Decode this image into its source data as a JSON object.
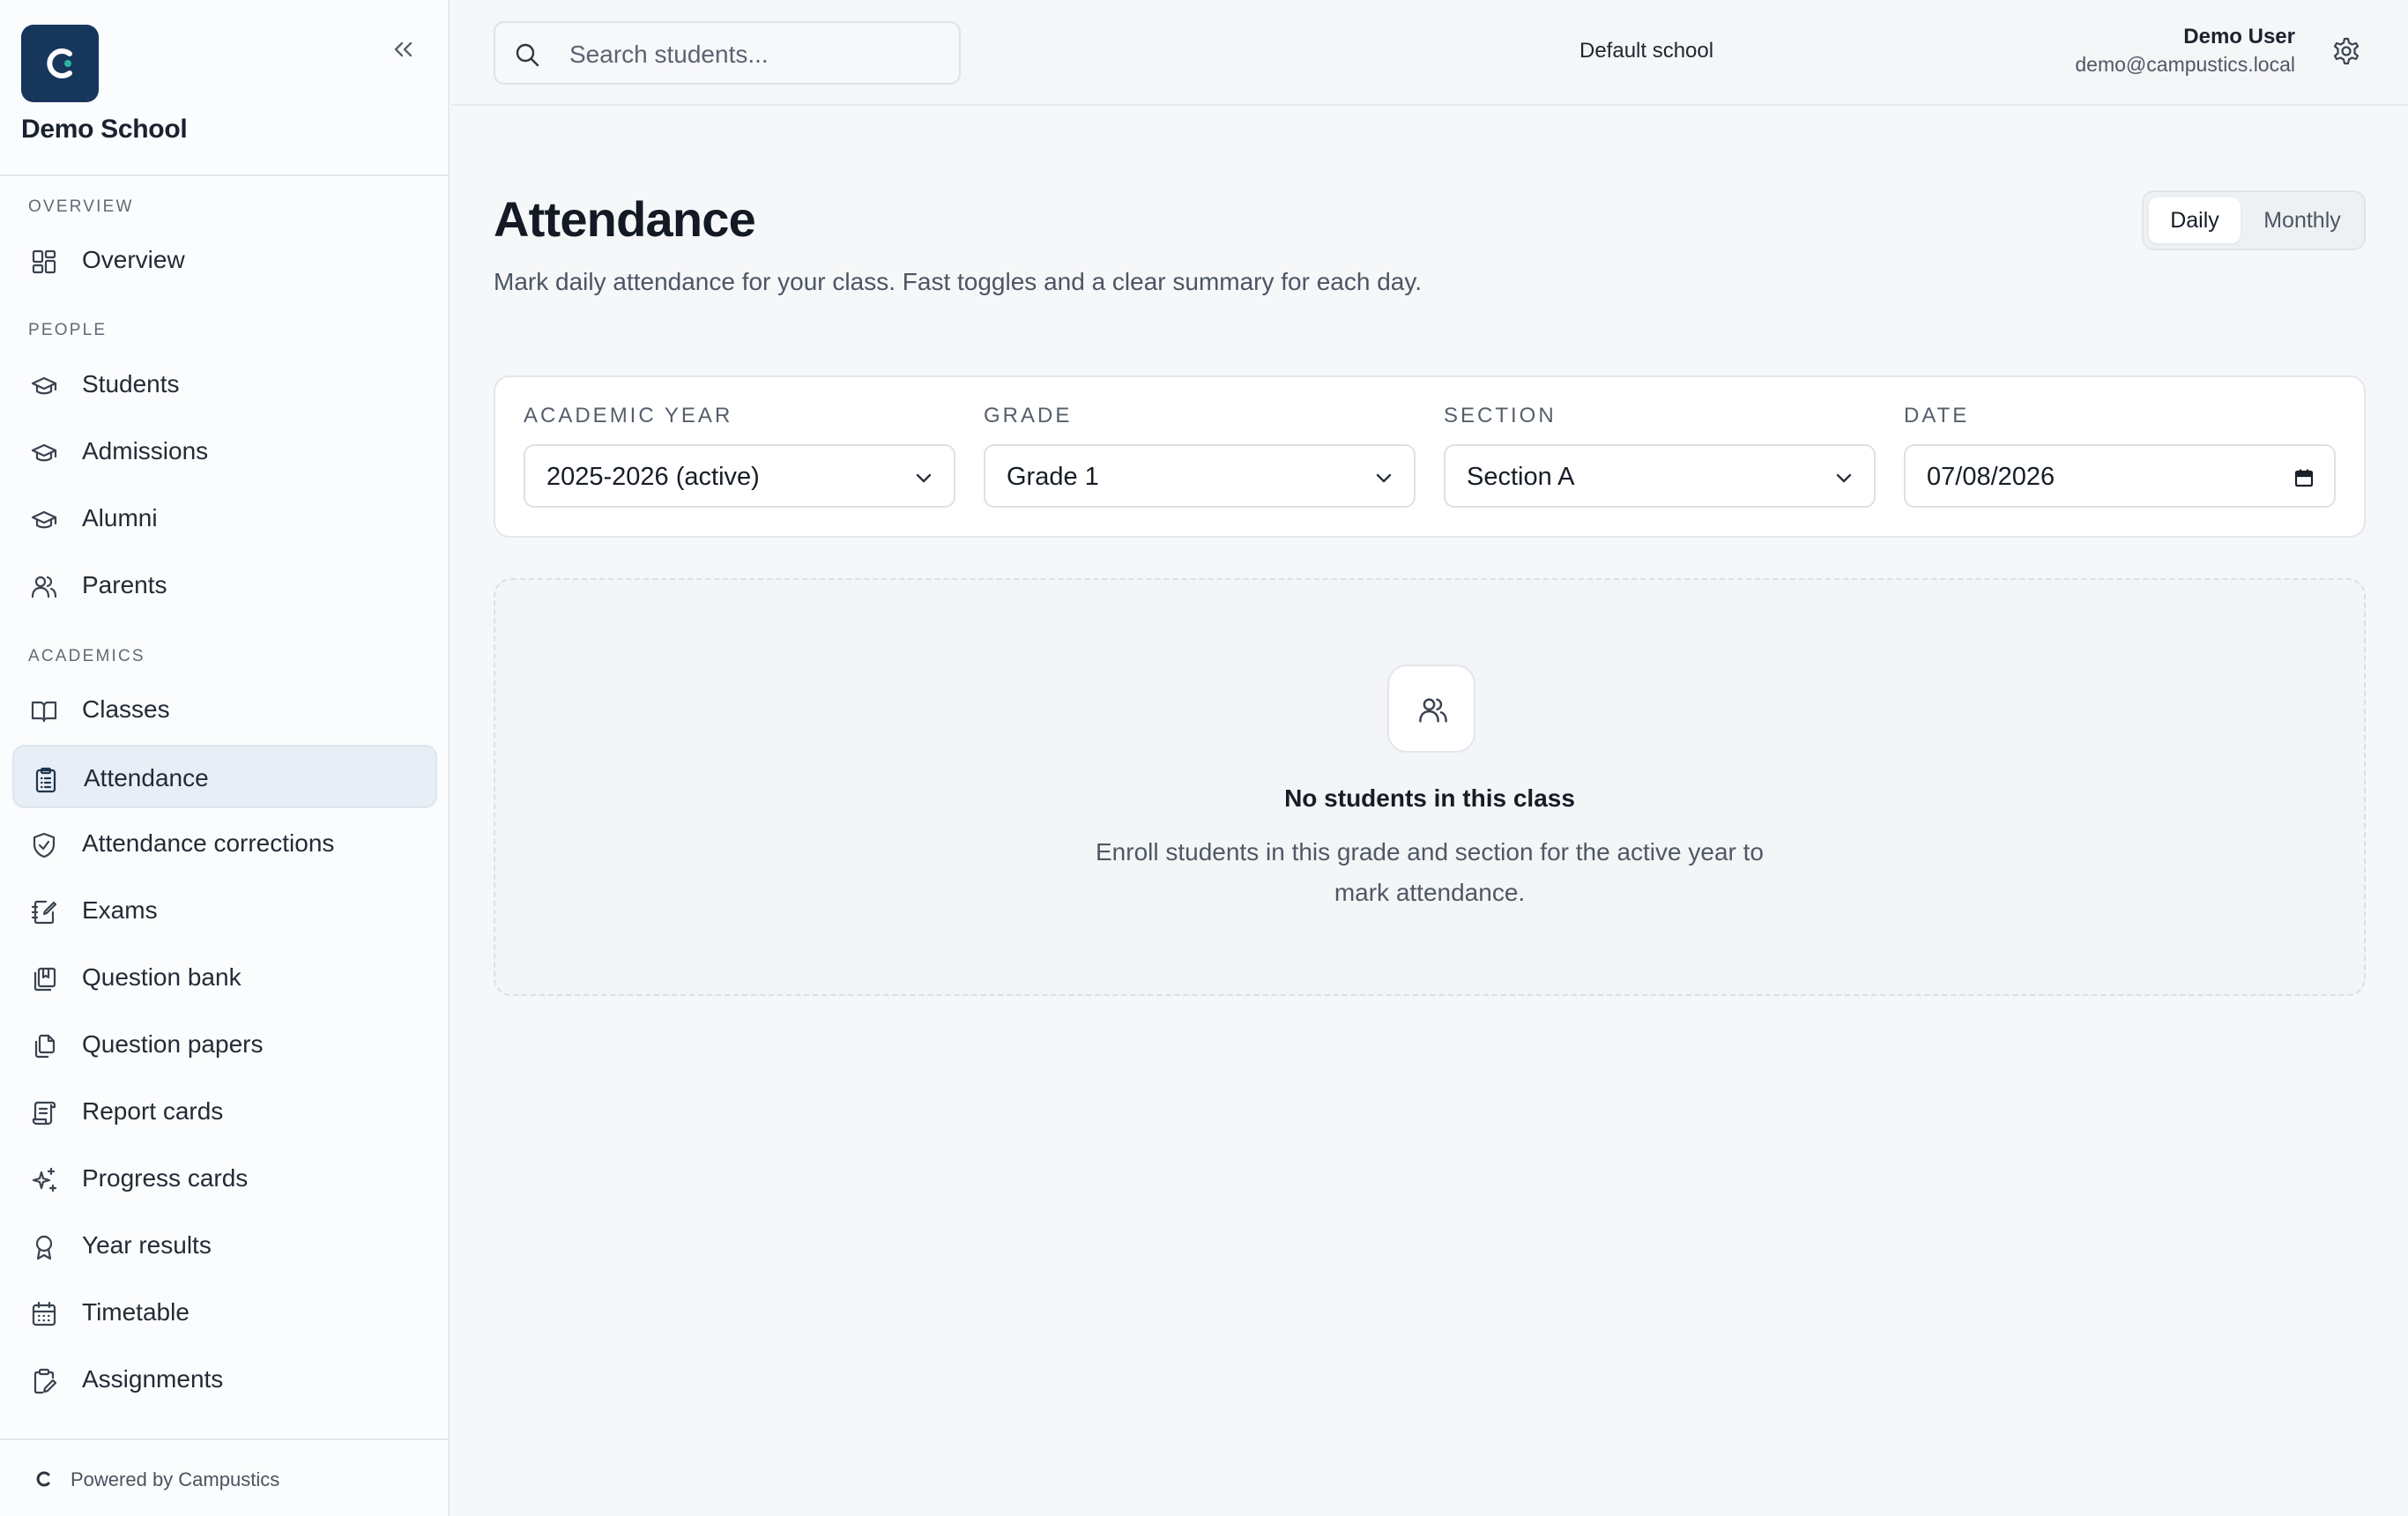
{
  "brand": {
    "logo_letter": "C",
    "school_name": "Demo School",
    "logo_color": "#16365c"
  },
  "sidebar": {
    "sections": [
      {
        "label": "OVERVIEW"
      },
      {
        "label": "PEOPLE"
      },
      {
        "label": "ACADEMICS"
      }
    ],
    "items": [
      {
        "label": "Overview",
        "icon": "dashboard-icon"
      },
      {
        "label": "Students",
        "icon": "graduation-cap-icon"
      },
      {
        "label": "Admissions",
        "icon": "graduation-cap-icon"
      },
      {
        "label": "Alumni",
        "icon": "graduation-cap-icon"
      },
      {
        "label": "Parents",
        "icon": "users-icon"
      },
      {
        "label": "Classes",
        "icon": "book-open-icon"
      },
      {
        "label": "Attendance",
        "icon": "clipboard-list-icon",
        "active": true
      },
      {
        "label": "Attendance corrections",
        "icon": "shield-check-icon"
      },
      {
        "label": "Exams",
        "icon": "notebook-pen-icon"
      },
      {
        "label": "Question bank",
        "icon": "library-icon"
      },
      {
        "label": "Question papers",
        "icon": "copy-icon"
      },
      {
        "label": "Report cards",
        "icon": "scroll-icon"
      },
      {
        "label": "Progress cards",
        "icon": "sparkles-icon"
      },
      {
        "label": "Year results",
        "icon": "award-icon"
      },
      {
        "label": "Timetable",
        "icon": "calendar-icon"
      },
      {
        "label": "Assignments",
        "icon": "clipboard-pen-icon"
      }
    ],
    "footer": "Powered by Campustics"
  },
  "topbar": {
    "search_placeholder": "Search students...",
    "school": "Default school",
    "user_name": "Demo User",
    "user_email": "demo@campustics.local"
  },
  "main": {
    "title": "Attendance",
    "subtitle": "Mark daily attendance for your class. Fast toggles and a clear summary for each day.",
    "view_toggle": {
      "options": [
        "Daily",
        "Monthly"
      ],
      "selected": "Daily"
    },
    "filters": [
      {
        "label": "ACADEMIC YEAR",
        "value": "2025-2026 (active)",
        "control": "chevron-down-icon"
      },
      {
        "label": "GRADE",
        "value": "Grade 1",
        "control": "chevron-down-icon"
      },
      {
        "label": "SECTION",
        "value": "Section A",
        "control": "chevron-down-icon"
      },
      {
        "label": "DATE",
        "value": "07/08/2026",
        "control": "calendar-icon"
      }
    ],
    "empty_state": {
      "icon": "users-icon",
      "title": "No students in this class",
      "description": "Enroll students in this grade and section for the active year to mark attendance."
    }
  }
}
